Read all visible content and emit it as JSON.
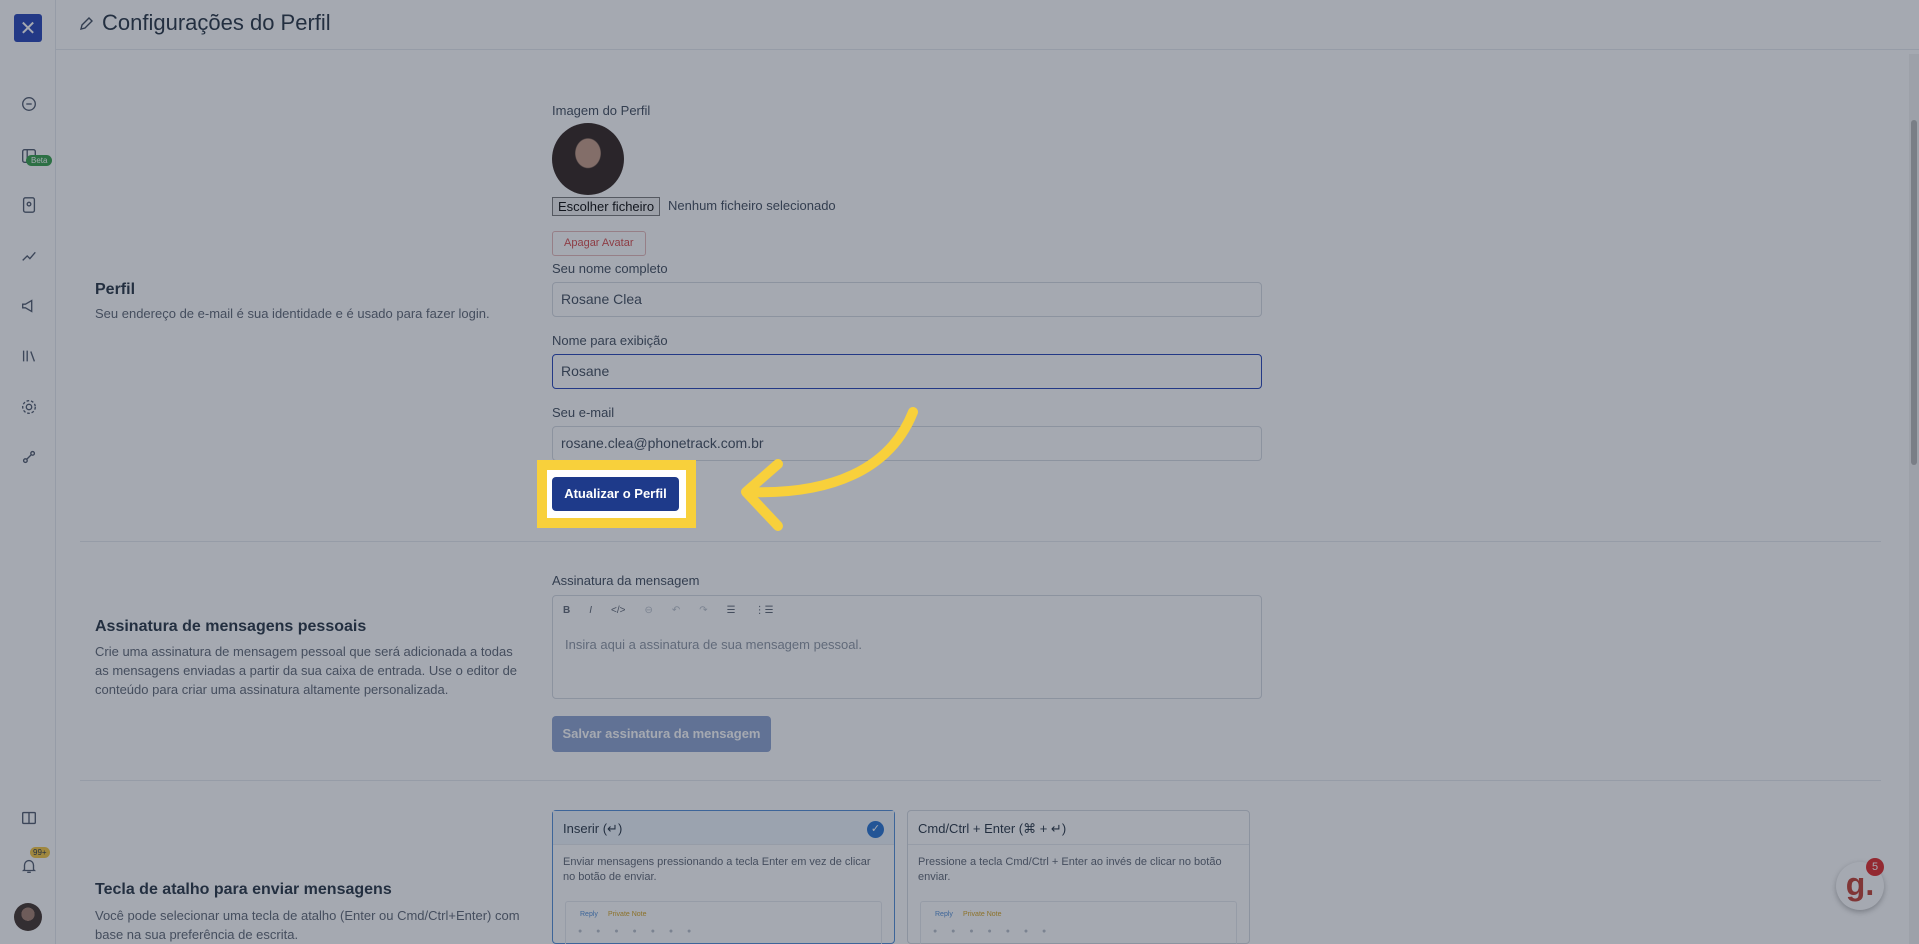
{
  "sidebar": {
    "logo": "✕",
    "beta_badge": "Beta",
    "notifications_badge": "99+"
  },
  "header": {
    "title": "Configurações do Perfil"
  },
  "profile": {
    "title": "Perfil",
    "description": "Seu endereço de e-mail é sua identidade e é usado para fazer login.",
    "image_label": "Imagem do Perfil",
    "choose_file": "Escolher ficheiro",
    "no_file": "Nenhum ficheiro selecionado",
    "delete_avatar": "Apagar Avatar",
    "full_name_label": "Seu nome completo",
    "full_name_value": "Rosane Clea",
    "display_name_label": "Nome para exibição",
    "display_name_value": "Rosane",
    "email_label": "Seu e-mail",
    "email_value": "rosane.clea@phonetrack.com.br",
    "update_button": "Atualizar o Perfil"
  },
  "signature": {
    "title": "Assinatura de mensagens pessoais",
    "description": "Crie uma assinatura de mensagem pessoal que será adicionada a todas as mensagens enviadas a partir da sua caixa de entrada. Use o editor de conteúdo para criar uma assinatura altamente personalizada.",
    "editor_label": "Assinatura da mensagem",
    "toolbar": [
      "B",
      "I",
      "</>",
      "⊖",
      "↶",
      "↷",
      "☰",
      "⋮☰"
    ],
    "placeholder": "Insira aqui a assinatura de sua mensagem pessoal.",
    "save_button": "Salvar assinatura da mensagem"
  },
  "hotkey": {
    "title": "Tecla de atalho para enviar mensagens",
    "description": "Você pode selecionar uma tecla de atalho (Enter ou Cmd/Ctrl+Enter) com base na sua preferência de escrita.",
    "options": [
      {
        "title": "Inserir (↵)",
        "description": "Enviar mensagens pressionando a tecla Enter em vez de clicar no botão de enviar.",
        "selected": true
      },
      {
        "title": "Cmd/Ctrl + Enter (⌘ + ↵)",
        "description": "Pressione a tecla Cmd/Ctrl + Enter ao invés de clicar no botão enviar.",
        "selected": false
      }
    ],
    "preview_tab_a": "Reply",
    "preview_tab_b": "Private Note"
  },
  "help": {
    "label": "g.",
    "count": "5"
  },
  "colors": {
    "accent": "#1e3a8a",
    "highlight": "#f8d03b",
    "overlay": "rgba(40,50,70,0.42)"
  }
}
